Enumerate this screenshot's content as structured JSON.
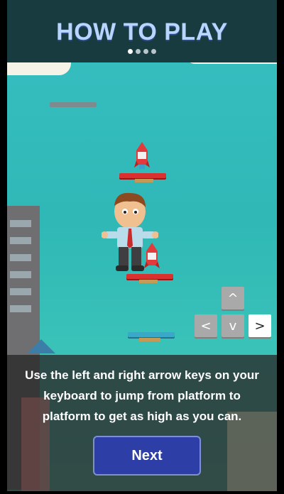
{
  "header": {
    "title": "HOW TO PLAY",
    "page_dots": {
      "total": 4,
      "active_index": 0
    }
  },
  "controls": {
    "up": "^",
    "left": "<",
    "down": "v",
    "right": ">"
  },
  "instructions": {
    "text": "Use the left and right arrow keys on your keyboard to jump from platform to platform to get as high as you can."
  },
  "buttons": {
    "next_label": "Next"
  },
  "colors": {
    "sky": "#38bfc2",
    "header_bg": "#173b3e",
    "title": "#b9d4ff",
    "next_button": "#2d3fa6",
    "red_platform": "#d93030",
    "blue_platform": "#3aa9c8"
  }
}
